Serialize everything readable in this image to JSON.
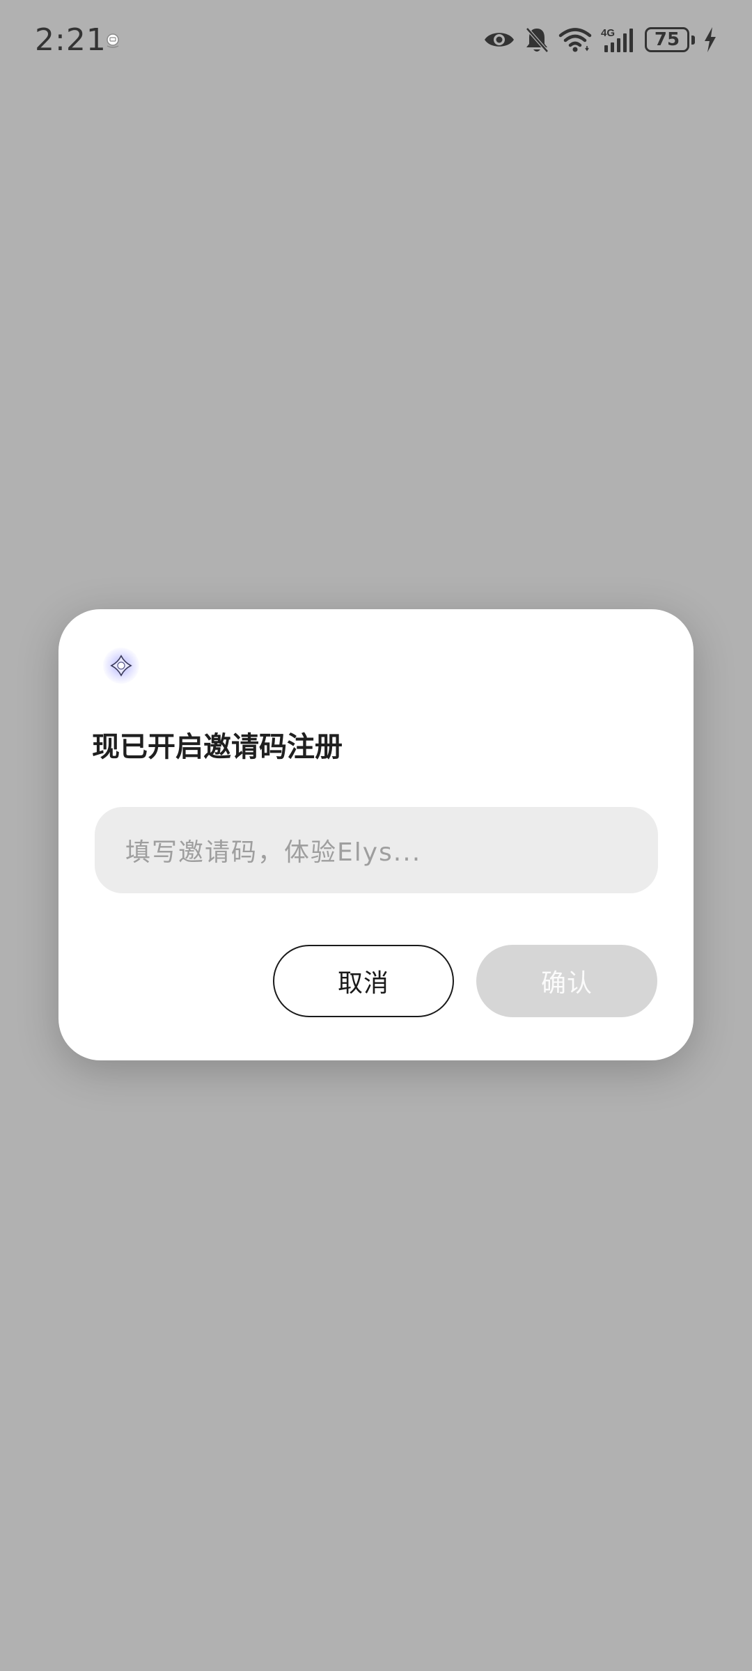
{
  "status_bar": {
    "time": "2:21",
    "notification_icon": "notification-app-icon",
    "icons": [
      "eye-icon",
      "bell-off-icon",
      "wifi-icon",
      "signal-4g-icon"
    ],
    "network_label": "4G",
    "battery_level": "75",
    "charging": true
  },
  "dialog": {
    "logo_icon": "app-logo-icon",
    "title": "现已开启邀请码注册",
    "input": {
      "placeholder": "填写邀请码，体验Elys...",
      "value": ""
    },
    "cancel_label": "取消",
    "confirm_label": "确认"
  },
  "colors": {
    "background_overlay": "#b1b1b1",
    "dialog_background": "#ffffff",
    "input_background": "#ececec",
    "confirm_disabled": "#d6d6d6",
    "text_primary": "#1a1a1a",
    "placeholder_text": "#9e9e9e"
  }
}
